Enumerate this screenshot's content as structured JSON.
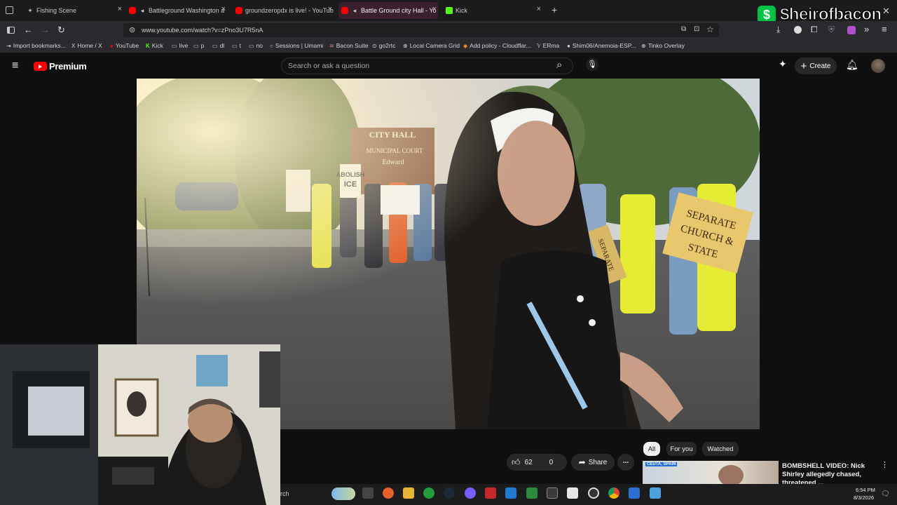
{
  "browser": {
    "tabs": [
      {
        "title": "Fishing Scene",
        "active": false
      },
      {
        "title": "Battleground Washington a",
        "active": false
      },
      {
        "title": "groundzeropdx is live! - YouTub",
        "active": false
      },
      {
        "title": "Battle Ground city Hall - Yo",
        "active": true
      },
      {
        "title": "Kick",
        "active": false
      }
    ],
    "new_tab": "+",
    "url": "www.youtube.com/watch?v=zPno3U7R5nA",
    "bookmarks": [
      "Import bookmarks...",
      "Home / X",
      "YouTube",
      "Kick",
      "live",
      "p",
      "dl",
      "t",
      "no",
      "Sessions | Umami",
      "Bacon Suite",
      "go2rtc",
      "Local Camera Grid",
      "Add policy - Cloudflar...",
      "ERma",
      "Shim06/Anemoia-ESP...",
      "Tinko Overlay"
    ]
  },
  "overlay": {
    "cashtag_symbol": "$",
    "cashtag": "$heirofbacon"
  },
  "youtube": {
    "logo_label": "Premium",
    "search_placeholder": "Search or ask a question",
    "create_label": "Create",
    "video_scene": {
      "signs": [
        "CITY HALL",
        "MUNICIPAL COURT",
        "Edward",
        "ABOLISH ICE",
        "SEPARATE CHURCH & STATE",
        "SEPARATE"
      ]
    },
    "actions": {
      "likes": "62",
      "dislikes": "0",
      "share": "Share",
      "more": "..."
    },
    "filter_chips": [
      "All",
      "For you",
      "Watched"
    ],
    "recommendation": {
      "thumb_caption": "CEUTA, SPAIN",
      "title": "BOMBSHELL VIDEO: Nick Shirley allegedly chased, threatened ..."
    }
  },
  "taskbar": {
    "search_fragment": "rch",
    "time": "6:54 PM",
    "date": "8/3/2026"
  },
  "colors": {
    "yt_red": "#ff0000",
    "cashapp_green": "#00c244",
    "active_tab": "#3a1f2c"
  }
}
